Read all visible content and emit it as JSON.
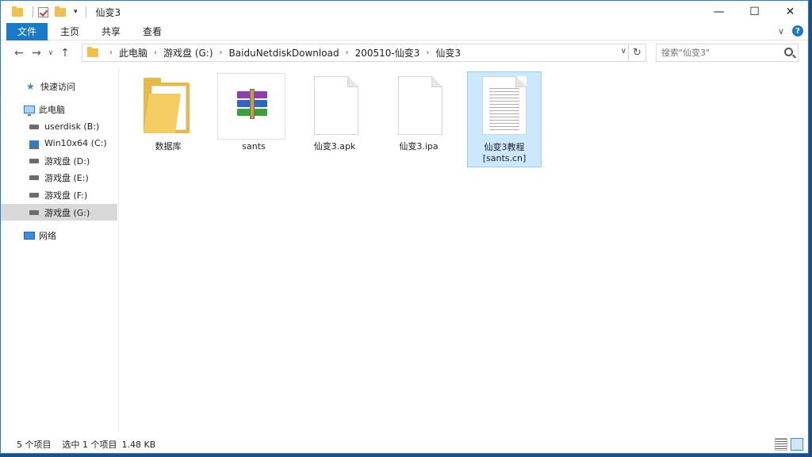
{
  "window": {
    "title": "仙变3",
    "controls": {
      "minimize": "—",
      "maximize": "☐",
      "close": "✕"
    }
  },
  "ribbon": {
    "tabs": [
      "文件",
      "主页",
      "共享",
      "查看"
    ],
    "expand_glyph": "∨",
    "help_glyph": "?"
  },
  "nav": {
    "back_glyph": "←",
    "forward_glyph": "→",
    "recent_glyph": "∨",
    "up_glyph": "↑",
    "breadcrumbs": [
      "此电脑",
      "游戏盘 (G:)",
      "BaiduNetdiskDownload",
      "200510-仙变3",
      "仙变3"
    ],
    "separator": "›",
    "dropdown_glyph": "∨",
    "refresh_glyph": "↻",
    "search_placeholder": "搜索\"仙变3\""
  },
  "sidebar": {
    "items": [
      {
        "label": "快速访问",
        "icon": "star-icon"
      },
      {
        "label": "此电脑",
        "icon": "computer-icon"
      },
      {
        "label": "userdisk (B:)",
        "icon": "drive-icon"
      },
      {
        "label": "Win10x64 (C:)",
        "icon": "windows-drive-icon"
      },
      {
        "label": "游戏盘 (D:)",
        "icon": "drive-icon"
      },
      {
        "label": "游戏盘 (E:)",
        "icon": "drive-icon"
      },
      {
        "label": "游戏盘 (F:)",
        "icon": "drive-icon"
      },
      {
        "label": "游戏盘 (G:)",
        "icon": "drive-icon",
        "selected": true
      },
      {
        "label": "网络",
        "icon": "network-icon"
      }
    ]
  },
  "files": [
    {
      "name": "数据库",
      "icon": "folder-icon"
    },
    {
      "name": "sants",
      "icon": "winrar-archive-icon"
    },
    {
      "name": "仙变3.apk",
      "icon": "blank-file-icon"
    },
    {
      "name": "仙变3.ipa",
      "icon": "blank-file-icon"
    },
    {
      "name_line1": "仙变3教程",
      "name_line2": "[sants.cn]",
      "icon": "text-file-icon",
      "selected": true
    }
  ],
  "status": {
    "item_count": "5 个项目",
    "selected": "选中 1 个项目",
    "size": "1.48 KB"
  }
}
